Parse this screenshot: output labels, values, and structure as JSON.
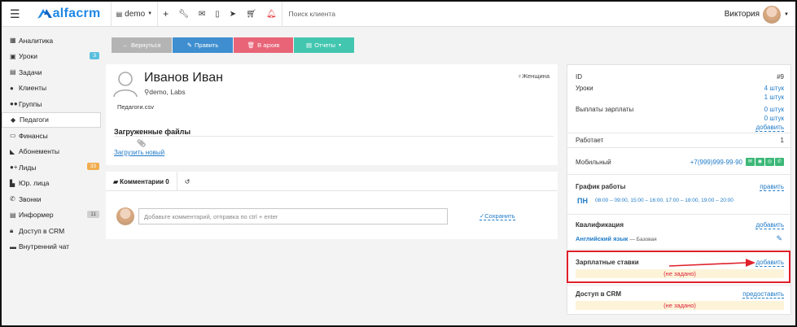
{
  "topbar": {
    "logo": "alfacrm",
    "branch": "demo",
    "search_placeholder": "Поиск клиента",
    "user_name": "Виктория",
    "icons": [
      "menu-icon",
      "plus-icon",
      "wrench-icon",
      "mail-icon",
      "mobile-icon",
      "telegram-icon",
      "cart-icon",
      "bell-icon"
    ]
  },
  "sidebar": {
    "items": [
      {
        "label": "Аналитика",
        "icon": "chart-icon",
        "badge": ""
      },
      {
        "label": "Уроки",
        "icon": "calendar-icon",
        "badge": "3",
        "badge_color": "#5bc0de"
      },
      {
        "label": "Задачи",
        "icon": "tasks-icon",
        "badge": ""
      },
      {
        "label": "Клиенты",
        "icon": "user-icon",
        "badge": ""
      },
      {
        "label": "Группы",
        "icon": "users-icon",
        "badge": ""
      },
      {
        "label": "Педагоги",
        "icon": "teacher-icon",
        "badge": "",
        "active": true
      },
      {
        "label": "Финансы",
        "icon": "money-icon",
        "badge": ""
      },
      {
        "label": "Абонементы",
        "icon": "tag-icon",
        "badge": ""
      },
      {
        "label": "Лиды",
        "icon": "lead-icon",
        "badge": "33",
        "badge_color": "#f0ad4e"
      },
      {
        "label": "Юр. лица",
        "icon": "bank-icon",
        "badge": ""
      },
      {
        "label": "Звонки",
        "icon": "phone-icon",
        "badge": ""
      },
      {
        "label": "Информер",
        "icon": "list-icon",
        "badge": "11",
        "badge_color": "#c9c9c9"
      },
      {
        "label": "Доступ в CRM",
        "icon": "lock-icon",
        "badge": ""
      },
      {
        "label": "Внутренний чат",
        "icon": "chat-icon",
        "badge": ""
      }
    ]
  },
  "toolbar": {
    "back": "Вернуться",
    "edit": "Править",
    "archive": "В архив",
    "reports": "Отчеты"
  },
  "profile": {
    "name": "Иванов Иван",
    "branch": "demo, Labs",
    "gender": "Женщина",
    "file": "Педагоги.csv",
    "uploaded_title": "Загруженные файлы",
    "upload_link": "Загрузить новый"
  },
  "comments": {
    "tab_label": "Комментарии 0",
    "placeholder": "Добавьте комментарий, отправка по ctrl + enter",
    "save": "Сохранить"
  },
  "right": {
    "id_label": "ID",
    "id_value": "#9",
    "lessons_label": "Уроки",
    "lessons_1": "4 штук",
    "lessons_2": "1 штук",
    "payouts_label": "Выплаты зарплаты",
    "payouts_1": "0 штук",
    "payouts_2": "0 штук",
    "payouts_add": "добавить",
    "works_label": "Работает",
    "works_value": "1",
    "mobile_label": "Мобильный",
    "mobile_value": "+7(999)999-99-90",
    "schedule_title": "График работы",
    "schedule_edit": "править",
    "schedule_day": "ПН",
    "schedule_times": "08:00 – 09:00, 15:00 – 16:00, 17:00 – 18:00, 19:00 – 20:00",
    "qual_title": "Квалификация",
    "qual_add": "добавить",
    "qual_subject": "Английский язык",
    "qual_level": "— Базовая",
    "salary_title": "Зарплатные ставки",
    "salary_add": "добавить",
    "salary_status": "(не задано)",
    "access_title": "Доступ в CRM",
    "access_link": "предоставить",
    "access_status": "(не задано)"
  },
  "colors": {
    "accent": "#1e88e5",
    "btn_back": "#b4b4b4",
    "btn_edit": "#3e8ed0",
    "btn_archive": "#e86477",
    "btn_reports": "#43c6b0",
    "highlight": "#e0212b"
  }
}
